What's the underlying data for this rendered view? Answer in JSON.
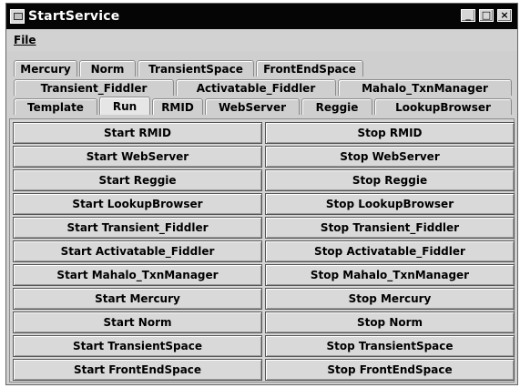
{
  "window": {
    "title": "StartService"
  },
  "window_controls": [
    "_",
    "□",
    "×"
  ],
  "menu": {
    "file": "File"
  },
  "tabs": [
    [
      "Mercury",
      "Norm",
      "TransientSpace",
      "FrontEndSpace"
    ],
    [
      "Transient_Fiddler",
      "Activatable_Fiddler",
      "Mahalo_TxnManager"
    ],
    [
      "Template",
      "Run",
      "RMID",
      "WebServer",
      "Reggie",
      "LookupBrowser"
    ]
  ],
  "selected_tab": "Run",
  "buttons": [
    {
      "start": "Start RMID",
      "stop": "Stop RMID"
    },
    {
      "start": "Start WebServer",
      "stop": "Stop WebServer"
    },
    {
      "start": "Start Reggie",
      "stop": "Stop Reggie"
    },
    {
      "start": "Start LookupBrowser",
      "stop": "Stop LookupBrowser"
    },
    {
      "start": "Start Transient_Fiddler",
      "stop": "Stop Transient_Fiddler"
    },
    {
      "start": "Start Activatable_Fiddler",
      "stop": "Stop Activatable_Fiddler"
    },
    {
      "start": "Start Mahalo_TxnManager",
      "stop": "Stop Mahalo_TxnManager"
    },
    {
      "start": "Start Mercury",
      "stop": "Stop Mercury"
    },
    {
      "start": "Start Norm",
      "stop": "Stop Norm"
    },
    {
      "start": "Start TransientSpace",
      "stop": "Stop TransientSpace"
    },
    {
      "start": "Start FrontEndSpace",
      "stop": "Stop FrontEndSpace"
    }
  ]
}
